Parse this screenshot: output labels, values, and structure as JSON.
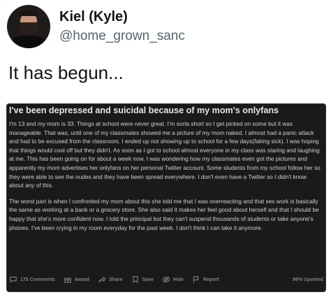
{
  "user": {
    "display_name": "Kiel (Kyle)",
    "handle": "@home_grown_sanc"
  },
  "tweet": {
    "text": "It has begun..."
  },
  "post": {
    "title": "I've been depressed and suicidal because of my mom's onlyfans",
    "paragraph_1": "I'm 13 and my mom is 33. Things at school were never great. I'm sorta short so I get picked on some but it was manageable. That was, until one of my classmates showed me a picture of my mom naked. I almost had a panic attack and had to be excused from the classroom. I ended up not showing up to school for a few days(faking sick). I was hoping that things would cool off but they didn't. As soon as I got to school almost everyone in my class was staring and laughing at me. This has been going on for about a week now. I was wondering how my classmates even got the pictures and apparently my mom advertises her onlyfans on her personal Twitter account. Some students from my school follow her so they were able to see the nudes and they have been spread everywhere. I don't even have a Twitter so I didn't know about any of this.",
    "paragraph_2": "The worst part is when I confronted my mom about this she told me that I was overreacting and that sex work is basically the same as working at a bank or a grocery store. She also said it makes her feel good about herself and that I should be happy that she's more confident now. I told the principal but they can't suspend thousands of students or take anyone's phones. I've been crying in my room everyday for the past week. I don't think I can take it anymore.",
    "actions": {
      "comments": "175 Comments",
      "award": "Award",
      "share": "Share",
      "save": "Save",
      "hide": "Hide",
      "report": "Report"
    },
    "upvoted": "96% Upvoted"
  }
}
